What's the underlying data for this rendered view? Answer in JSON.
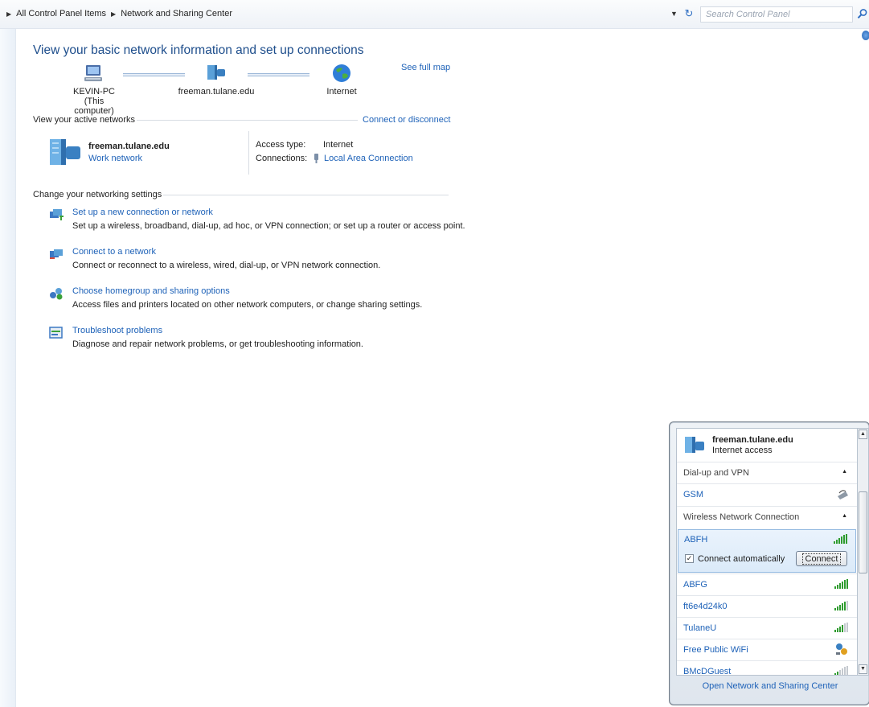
{
  "breadcrumb": {
    "items": [
      "All Control Panel Items",
      "Network and Sharing Center"
    ]
  },
  "search": {
    "placeholder": "Search Control Panel"
  },
  "main": {
    "title": "View your basic network information and set up connections",
    "see_full_map": "See full map",
    "map": {
      "computer_name": "KEVIN-PC",
      "computer_sub": "(This computer)",
      "network_name": "freeman.tulane.edu",
      "internet": "Internet"
    },
    "active": {
      "heading": "View your active networks",
      "connect_link": "Connect or disconnect",
      "network_name": "freeman.tulane.edu",
      "network_type": "Work network",
      "access_label": "Access type:",
      "access_value": "Internet",
      "connections_label": "Connections:",
      "connections_value": "Local Area Connection"
    },
    "settings": {
      "heading": "Change your networking settings",
      "tasks": [
        {
          "title": "Set up a new connection or network",
          "desc": "Set up a wireless, broadband, dial-up, ad hoc, or VPN connection; or set up a router or access point."
        },
        {
          "title": "Connect to a network",
          "desc": "Connect or reconnect to a wireless, wired, dial-up, or VPN network connection."
        },
        {
          "title": "Choose homegroup and sharing options",
          "desc": "Access files and printers located on other network computers, or change sharing settings."
        },
        {
          "title": "Troubleshoot problems",
          "desc": "Diagnose and repair network problems, or get troubleshooting information."
        }
      ]
    }
  },
  "flyout": {
    "current_name": "freeman.tulane.edu",
    "current_status": "Internet access",
    "dialup_header": "Dial-up and VPN",
    "gsm": "GSM",
    "wireless_header": "Wireless Network Connection",
    "selected": "ABFH",
    "connect_auto": "Connect automatically",
    "connect_button": "Connect",
    "networks": [
      "ABFG",
      "ft6e4d24k0",
      "TulaneU",
      "Free Public WiFi",
      "BMcDGuest"
    ],
    "footer": "Open Network and Sharing Center"
  },
  "colors": {
    "link": "#1e62b8",
    "title": "#1e4e8c",
    "selection": "#dbeaf9"
  }
}
